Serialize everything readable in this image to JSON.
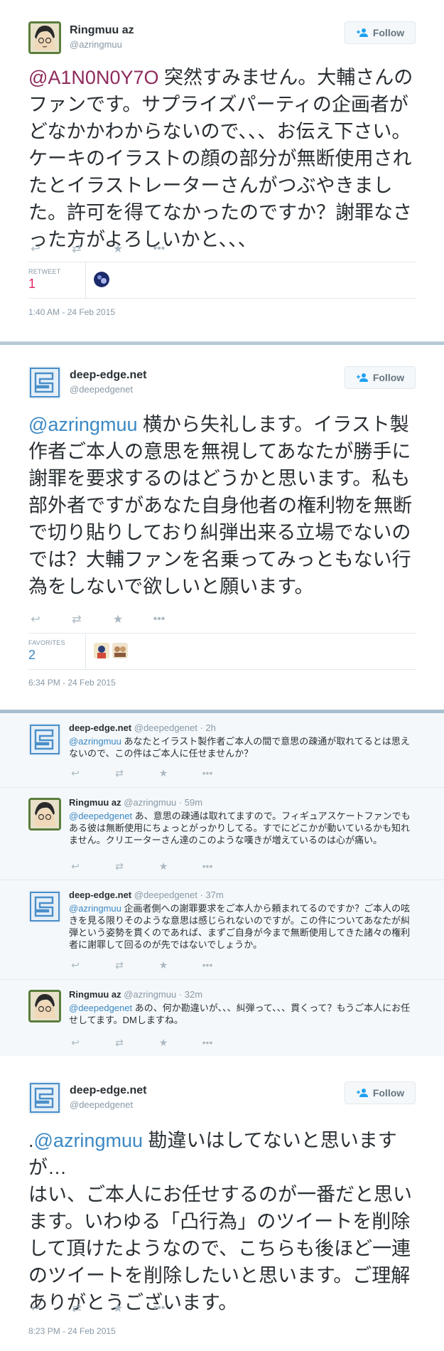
{
  "tweet1": {
    "name": "Ringmuu az",
    "handle": "@azringmuu",
    "follow_label": "Follow",
    "mention": "@A1N0N0Y7O",
    "text": " 突然すみません。大輔さんのファンです。サプライズパーティの企画者がどなかかわからないので、、、お伝え下さい。ケーキのイラストの顔の部分が無断使用されたとイラストレーターさんがつぶやきました。許可を得てなかったのですか？謝罪なさった方がよろしいかと、、、",
    "stat_label": "RETWEET",
    "stat_value": "1",
    "timestamp": "1:40 AM - 24 Feb 2015"
  },
  "tweet2": {
    "name": "deep-edge.net",
    "handle": "@deepedgenet",
    "follow_label": "Follow",
    "mention": "@azringmuu",
    "text": " 横から失礼します。イラスト製作者ご本人の意思を無視してあなたが勝手に謝罪を要求するのはどうかと思います。私も部外者ですがあなた自身他者の権利物を無断で切り貼りしており糾弾出来る立場でないのでは？大輔ファンを名乗ってみっともない行為をしないで欲しいと願います。",
    "stat_label": "FAVORITES",
    "stat_value": "2",
    "timestamp": "6:34 PM - 24 Feb 2015"
  },
  "replies": [
    {
      "name": "deep-edge.net",
      "meta": "@deepedgenet · 2h",
      "mention": "@azringmuu",
      "text": " あなたとイラスト製作者ご本人の間で意思の疎通が取れてるとは思えないので、この件はご本人に任せませんか？"
    },
    {
      "name": "Ringmuu az",
      "meta": "@azringmuu · 59m",
      "mention": "@deepedgenet",
      "text": " あ、意思の疎通は取れてますので。フィギュアスケートファンでもある彼は無断使用にちょっとがっかりしてる。すでにどこかが動いているかも知れません。クリエーターさん達のこのような嘆きが増えているのは心が痛い。"
    },
    {
      "name": "deep-edge.net",
      "meta": "@deepedgenet · 37m",
      "mention": "@azringmuu",
      "text": " 企画者側への謝罪要求をご本人から頼まれてるのですか？ご本人の呟きを見る限りそのような意思は感じられないのですが。この件についてあなたが糾弾という姿勢を貫くのであれば、まずご自身が今まで無断使用してきた諸々の権利者に謝罪して回るのが先ではないでしょうか。"
    },
    {
      "name": "Ringmuu az",
      "meta": "@azringmuu · 32m",
      "mention": "@deepedgenet",
      "text": " あの、何か勘違いが、、、糾弾って、、、貫くって？もうご本人にお任せしてます。DMしますね。"
    }
  ],
  "tweet3": {
    "name": "deep-edge.net",
    "handle": "@deepedgenet",
    "follow_label": "Follow",
    "prefix": ".",
    "mention": "@azringmuu",
    "text": " 勘違いはしてないと思いますが…\nはい、ご本人にお任せするのが一番だと思います。いわゆる「凸行為」のツイートを削除して頂けたようなので、こちらも後ほど一連のツイートを削除したいと思います。ご理解ありがとうございます。",
    "timestamp": "8:23 PM - 24 Feb 2015"
  },
  "icons": {
    "reply": "reply-icon",
    "retweet": "retweet-icon",
    "favorite": "star-icon",
    "more": "more-icon"
  },
  "colors": {
    "mention_pink": "#8e2b5c",
    "mention_blue": "#3b88c3",
    "stat_pink": "#e0245e",
    "stat_blue": "#3b88c3"
  }
}
